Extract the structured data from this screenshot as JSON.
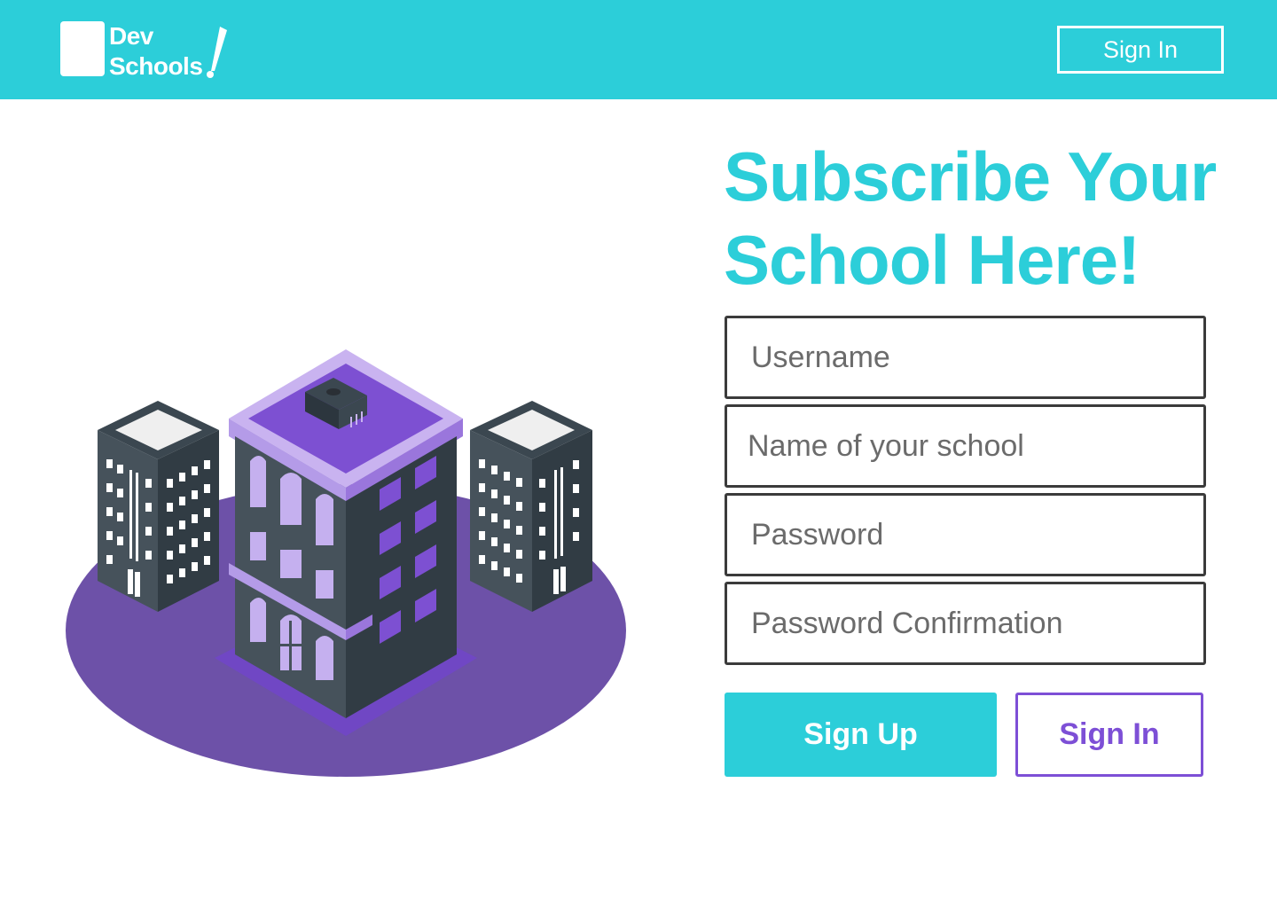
{
  "header": {
    "logo_line1": "Dev",
    "logo_line2": "Schools",
    "signin_label": "Sign In"
  },
  "hero": {
    "headline_line1": "Subscribe Your",
    "headline_line2": "School Here!"
  },
  "form": {
    "username_placeholder": "Username",
    "school_placeholder": "Name of your school",
    "password_placeholder": "Password",
    "confirm_placeholder": "Password Confirmation",
    "signup_label": "Sign Up",
    "signin_label": "Sign In"
  },
  "colors": {
    "brand": "#2cced9",
    "accent": "#7d4fd6",
    "border": "#3b3b3b"
  }
}
